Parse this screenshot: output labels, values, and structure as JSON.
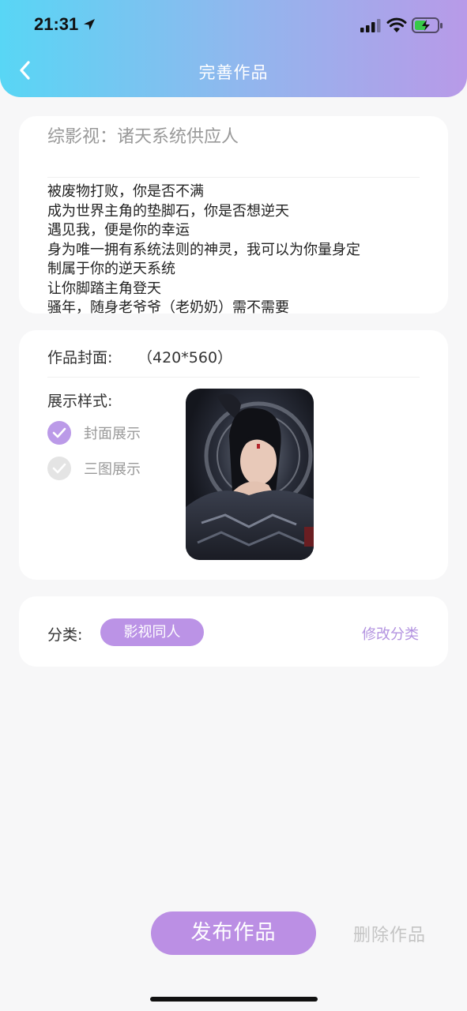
{
  "status_bar": {
    "time": "21:31"
  },
  "header": {
    "title": "完善作品"
  },
  "work": {
    "title": "综影视：诸天系统供应人",
    "synopsis_lines": [
      "被废物打败，你是否不满",
      "成为世界主角的垫脚石，你是否想逆天",
      "遇见我，便是你的幸运",
      "身为唯一拥有系统法则的神灵，我可以为你量身定",
      "制属于你的逆天系统",
      "让你脚踏主角登天",
      "骚年，随身老爷爷（老奶奶）需不需要"
    ]
  },
  "cover": {
    "label": "作品封面:",
    "size": "（420*560）",
    "style_label": "展示样式:",
    "options": [
      {
        "label": "封面展示",
        "checked": true
      },
      {
        "label": "三图展示",
        "checked": false
      }
    ]
  },
  "category": {
    "label": "分类:",
    "tag": "影视同人",
    "edit": "修改分类"
  },
  "actions": {
    "publish": "发布作品",
    "delete": "删除作品"
  },
  "colors": {
    "accent": "#bb8fe4",
    "header_gradient_start": "#58d6f5",
    "header_gradient_end": "#b89ae8"
  }
}
